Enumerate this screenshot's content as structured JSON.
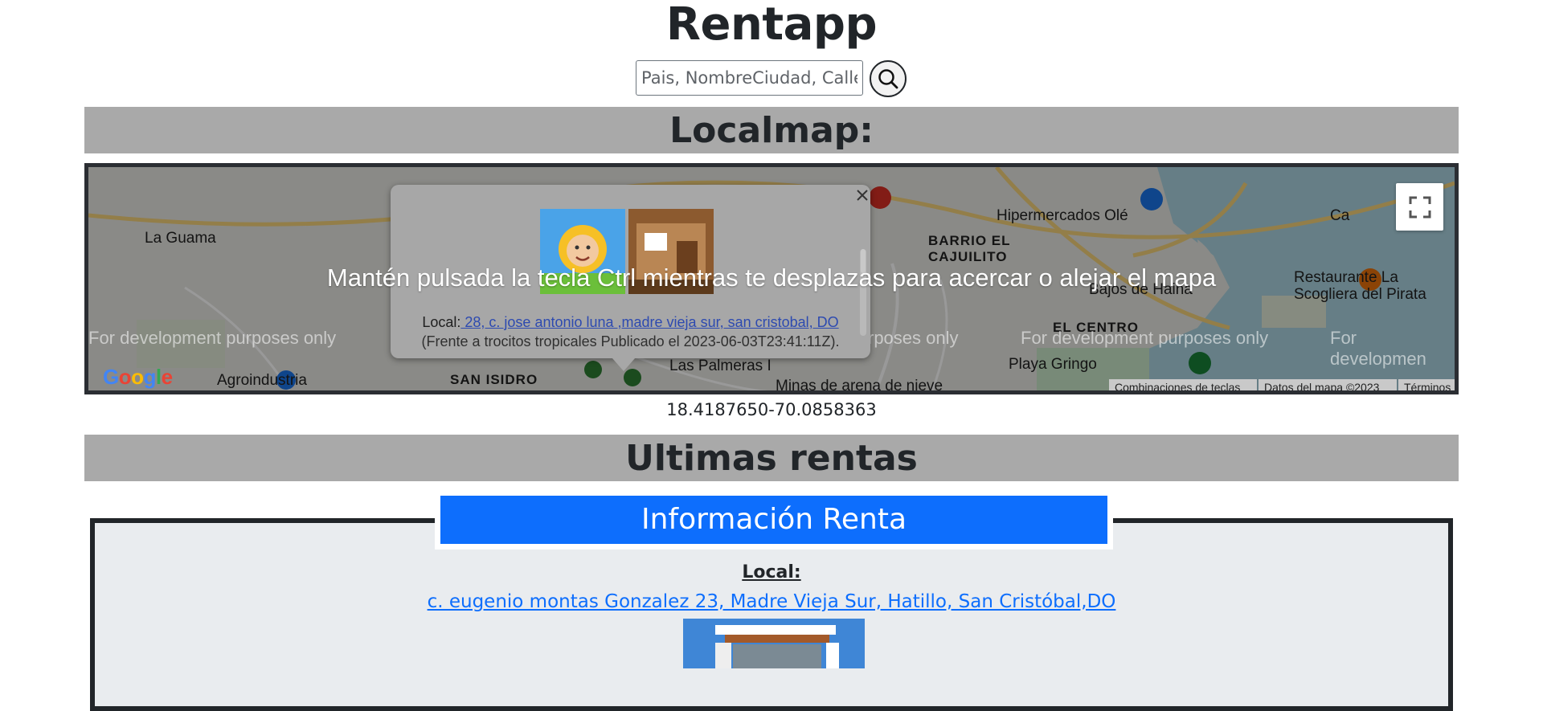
{
  "app": {
    "title": "Rentapp"
  },
  "search": {
    "placeholder": "Pais, NombreCiudad, Calle"
  },
  "sections": {
    "localmap_title": "Localmap:",
    "latest_title": "Ultimas rentas"
  },
  "map": {
    "ctrl_message": "Mantén pulsada la tecla Ctrl mientras te desplazas para acercar o alejar el mapa",
    "dev_watermark": "For development purposes only",
    "dev_watermark_partial": "For developmen",
    "dev_watermark_partial_mid": "rposes only",
    "labels": {
      "la_guama": "La Guama",
      "barrio_1": "BARRIO EL",
      "barrio_2": "CAJUILITO",
      "hipermercados": "Hipermercados Olé",
      "restaurante_1": "Restaurante La",
      "restaurante_2": "Scogliera del Pirata",
      "bajos": "Bajos de Haina",
      "el_centro": "EL CENTRO",
      "playa": "Playa Gringo",
      "agroindustria": "Agroindustria",
      "san_isidro": "SAN ISIDRO",
      "las_palmeras": "Las Palmeras I",
      "minas": "Minas de arena de nieve",
      "ca": "Ca"
    },
    "google_logo": "Google",
    "attribution": {
      "shortcuts": "Combinaciones de teclas",
      "map_data": "Datos del mapa ©2023",
      "terms": "Términos"
    },
    "popup": {
      "local_label": "Local:",
      "local_link": " 28, c. jose antonio luna ,madre vieja sur, san cristobal, DO",
      "description": "(Frente a trocitos tropicales Publicado el 2023-06-03T23:41:11Z)."
    },
    "icons": [
      "fullscreen-icon",
      "close-icon",
      "cart-icon",
      "restaurant-icon",
      "fuel-icon",
      "park-icon",
      "check-marker-icon"
    ]
  },
  "coordinates": "18.4187650-70.0858363",
  "latest_rent": {
    "header": "Información Renta",
    "local_label": "Local:",
    "address": "c. eugenio montas Gonzalez 23, Madre Vieja Sur, Hatillo, San Cristóbal,DO"
  },
  "colors": {
    "band": "#a9a9a9",
    "header_blue": "#0d6efd",
    "card_bg": "#e9ecef",
    "border_dark": "#212529"
  }
}
